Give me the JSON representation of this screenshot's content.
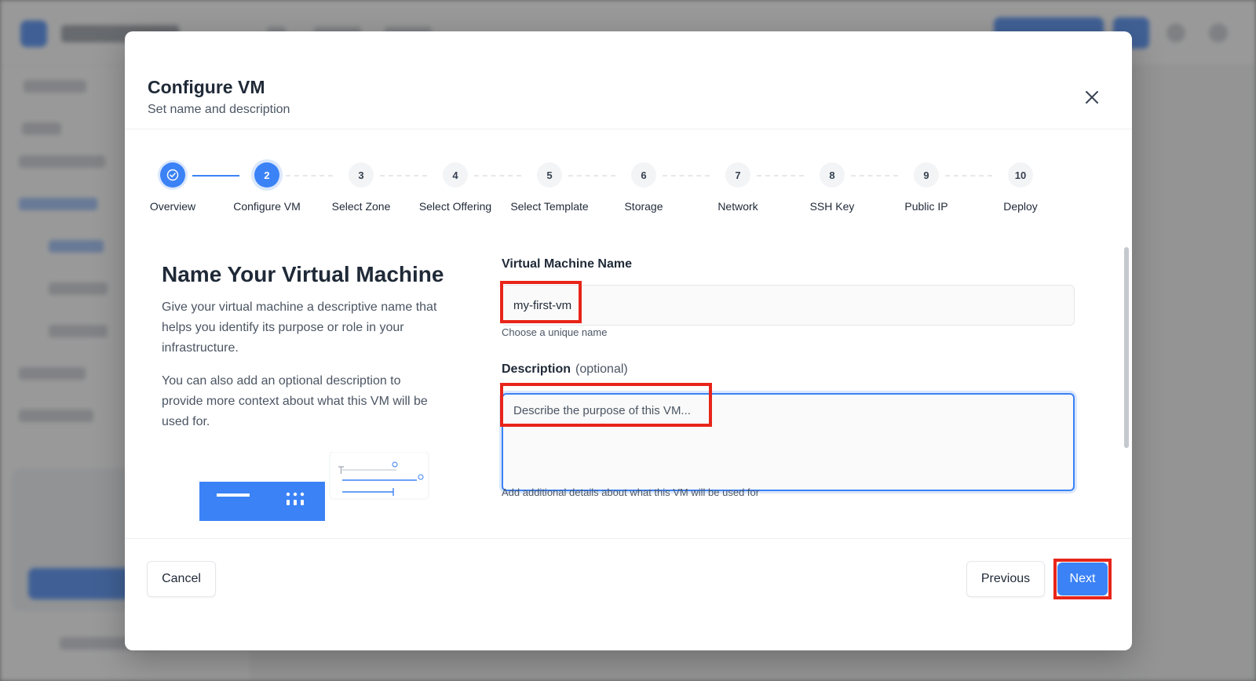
{
  "modal": {
    "title": "Configure VM",
    "subtitle": "Set name and description"
  },
  "stepper": {
    "steps": [
      {
        "label": "Overview",
        "state": "done"
      },
      {
        "number": "2",
        "label": "Configure VM",
        "state": "active"
      },
      {
        "number": "3",
        "label": "Select Zone",
        "state": "pending"
      },
      {
        "number": "4",
        "label": "Select Offering",
        "state": "pending"
      },
      {
        "number": "5",
        "label": "Select Template",
        "state": "pending"
      },
      {
        "number": "6",
        "label": "Storage",
        "state": "pending"
      },
      {
        "number": "7",
        "label": "Network",
        "state": "pending"
      },
      {
        "number": "8",
        "label": "SSH Key",
        "state": "pending"
      },
      {
        "number": "9",
        "label": "Public IP",
        "state": "pending"
      },
      {
        "number": "10",
        "label": "Deploy",
        "state": "pending"
      }
    ]
  },
  "intro": {
    "heading": "Name Your Virtual Machine",
    "paragraph1": "Give your virtual machine a descriptive name that helps you identify its purpose or role in your infrastructure.",
    "paragraph2": "You can also add an optional description to provide more context about what this VM will be used for."
  },
  "form": {
    "name_label": "Virtual Machine Name",
    "name_value": "my-first-vm",
    "name_help": "Choose a unique name",
    "desc_label": "Description",
    "desc_optional": "(optional)",
    "desc_placeholder": "Describe the purpose of this VM...",
    "desc_help": "Add additional details about what this VM will be used for"
  },
  "footer": {
    "cancel_label": "Cancel",
    "previous_label": "Previous",
    "next_label": "Next"
  },
  "colors": {
    "accent": "#3b82f6",
    "annotation": "#e8251a"
  }
}
